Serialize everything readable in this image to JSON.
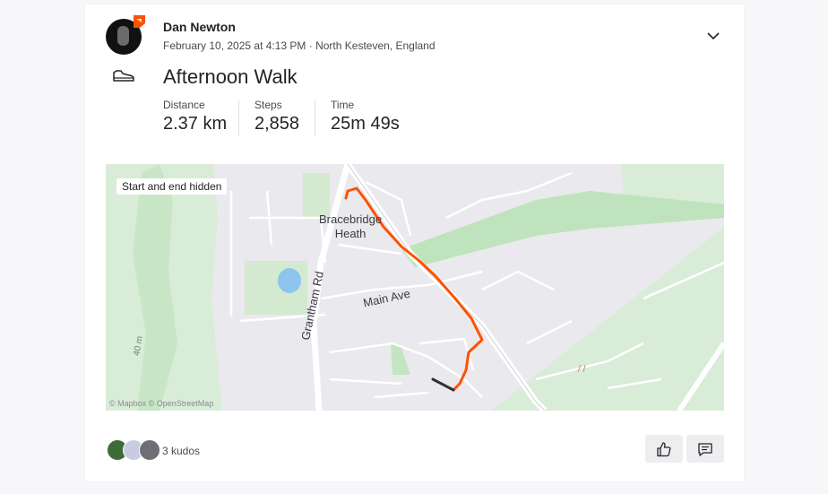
{
  "activity": {
    "athlete_name": "Dan Newton",
    "meta": "February 10, 2025 at 4:13 PM · North Kesteven, England",
    "title": "Afternoon Walk",
    "activity_icon": "shoe-icon"
  },
  "stats": [
    {
      "label": "Distance",
      "value": "2.37 km"
    },
    {
      "label": "Steps",
      "value": "2,858"
    },
    {
      "label": "Time",
      "value": "25m 49s"
    }
  ],
  "map": {
    "privacy_label": "Start and end hidden",
    "attribution": "© Mapbox © OpenStreetMap",
    "labels": {
      "town": "Bracebridge\nHeath",
      "main_ave": "Main Ave",
      "grantham_rd": "Grantham Rd",
      "elevation": "40 m"
    },
    "route_color": "#fc5200"
  },
  "kudos": {
    "count_label": "3 kudos"
  },
  "actions": {
    "kudos_icon": "thumbs-up-icon",
    "comment_icon": "comment-icon",
    "menu_icon": "chevron-down-icon"
  }
}
